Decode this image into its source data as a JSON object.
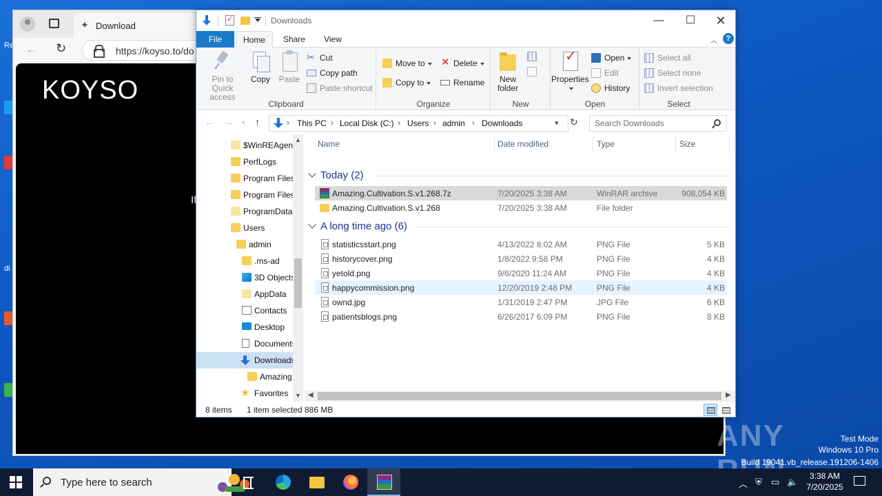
{
  "desktop": {
    "watermark": {
      "logo": "ANY RUN",
      "line1": "Test Mode",
      "line2": "Windows 10 Pro",
      "line3": "Build 19041.vb_release.191206-1406"
    },
    "edge_labels": [
      "Re",
      "di"
    ]
  },
  "browser": {
    "tab_title": "Download",
    "url": "https://koyso.to/do",
    "site_logo": "KOYSO",
    "site_text": "If"
  },
  "explorer": {
    "title": "Downloads",
    "ribbon_tabs": [
      "File",
      "Home",
      "Share",
      "View"
    ],
    "clipboard": {
      "pin": "Pin to Quick access",
      "copy": "Copy",
      "paste": "Paste",
      "cut": "Cut",
      "copy_path": "Copy path",
      "paste_shortcut": "Paste shortcut",
      "label": "Clipboard"
    },
    "organize": {
      "move_to": "Move to",
      "copy_to": "Copy to",
      "delete": "Delete",
      "rename": "Rename",
      "label": "Organize"
    },
    "new": {
      "new_folder": "New folder",
      "label": "New"
    },
    "open": {
      "properties": "Properties",
      "open": "Open",
      "edit": "Edit",
      "history": "History",
      "label": "Open"
    },
    "select": {
      "select_all": "Select all",
      "select_none": "Select none",
      "invert": "Invert selection",
      "label": "Select"
    },
    "breadcrumb": [
      "This PC",
      "Local Disk (C:)",
      "Users",
      "admin",
      "Downloads"
    ],
    "search_placeholder": "Search Downloads",
    "nav_items": [
      {
        "label": "$WinREAgent",
        "icon": "folder-light"
      },
      {
        "label": "PerfLogs",
        "icon": "folder"
      },
      {
        "label": "Program Files",
        "icon": "folder"
      },
      {
        "label": "Program Files",
        "icon": "folder"
      },
      {
        "label": "ProgramData",
        "icon": "folder-light"
      },
      {
        "label": "Users",
        "icon": "folder"
      },
      {
        "label": "admin",
        "icon": "folder"
      },
      {
        "label": ".ms-ad",
        "icon": "folder"
      },
      {
        "label": "3D Objects",
        "icon": "cube"
      },
      {
        "label": "AppData",
        "icon": "folder-light"
      },
      {
        "label": "Contacts",
        "icon": "contacts"
      },
      {
        "label": "Desktop",
        "icon": "desktop"
      },
      {
        "label": "Documents",
        "icon": "documents"
      },
      {
        "label": "Downloads",
        "icon": "downloads"
      },
      {
        "label": "Amazing",
        "icon": "folder"
      },
      {
        "label": "Favorites",
        "icon": "star"
      }
    ],
    "columns": [
      "Name",
      "Date modified",
      "Type",
      "Size"
    ],
    "groups": [
      {
        "title": "Today (2)",
        "files": [
          {
            "name": "Amazing.Cultivation.S.v1.268.7z",
            "date": "7/20/2025 3:38 AM",
            "type": "WinRAR archive",
            "size": "908,054 KB",
            "icon": "rar"
          },
          {
            "name": "Amazing.Cultivation.S.v1.268",
            "date": "7/20/2025 3:38 AM",
            "type": "File folder",
            "size": "",
            "icon": "folder"
          }
        ]
      },
      {
        "title": "A long time ago (6)",
        "files": [
          {
            "name": "statisticsstart.png",
            "date": "4/13/2022 8:02 AM",
            "type": "PNG File",
            "size": "5 KB",
            "icon": "png"
          },
          {
            "name": "historycover.png",
            "date": "1/8/2022 9:58 PM",
            "type": "PNG File",
            "size": "4 KB",
            "icon": "png"
          },
          {
            "name": "yetold.png",
            "date": "9/6/2020 11:24 AM",
            "type": "PNG File",
            "size": "4 KB",
            "icon": "png"
          },
          {
            "name": "happycommission.png",
            "date": "12/20/2019 2:48 PM",
            "type": "PNG File",
            "size": "4 KB",
            "icon": "png"
          },
          {
            "name": "ownd.jpg",
            "date": "1/31/2019 2:47 PM",
            "type": "JPG File",
            "size": "6 KB",
            "icon": "png"
          },
          {
            "name": "patientsblogs.png",
            "date": "6/26/2017 6:09 PM",
            "type": "PNG File",
            "size": "8 KB",
            "icon": "png"
          }
        ]
      }
    ],
    "status": {
      "count": "8 items",
      "selected": "1 item selected",
      "size": "886 MB"
    }
  },
  "taskbar": {
    "search_text": "Type here to search",
    "time": "3:38 AM",
    "date": "7/20/2025"
  }
}
